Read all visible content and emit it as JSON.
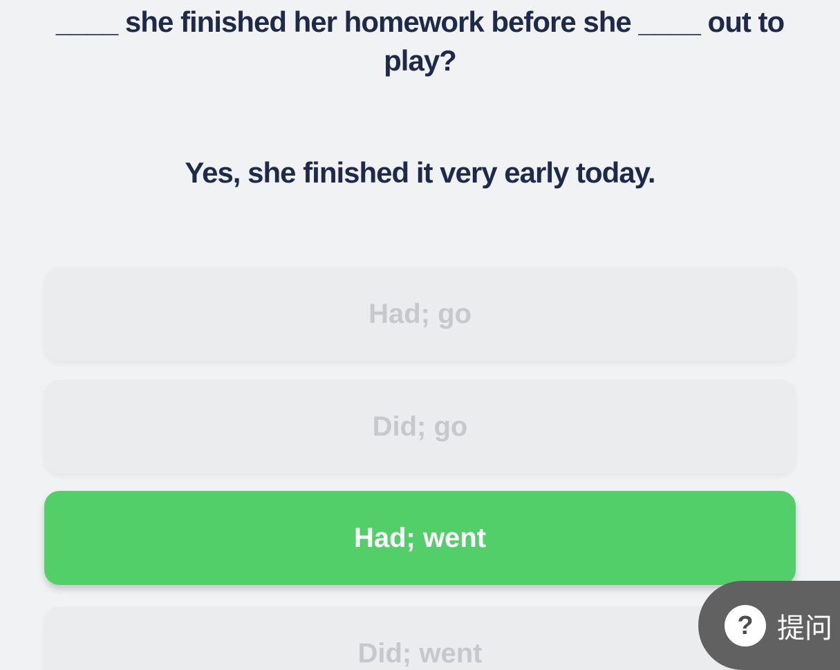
{
  "question": {
    "text": "____ she finished her homework before she ____ out to play?"
  },
  "response": {
    "text": "Yes, she finished it very early today."
  },
  "options": [
    {
      "label": "Had; go",
      "selected": false
    },
    {
      "label": "Did; go",
      "selected": false
    },
    {
      "label": "Had; went",
      "selected": true
    },
    {
      "label": "Did; went",
      "selected": false
    }
  ],
  "ask_button": {
    "icon": "question-icon",
    "icon_glyph": "?",
    "label": "提问"
  },
  "colors": {
    "background": "#f1f2f4",
    "text": "#1e2a4a",
    "option_bg": "#ebecee",
    "option_text": "#c6c8cc",
    "selected_bg": "#52cf68",
    "ask_bg": "#616161"
  }
}
